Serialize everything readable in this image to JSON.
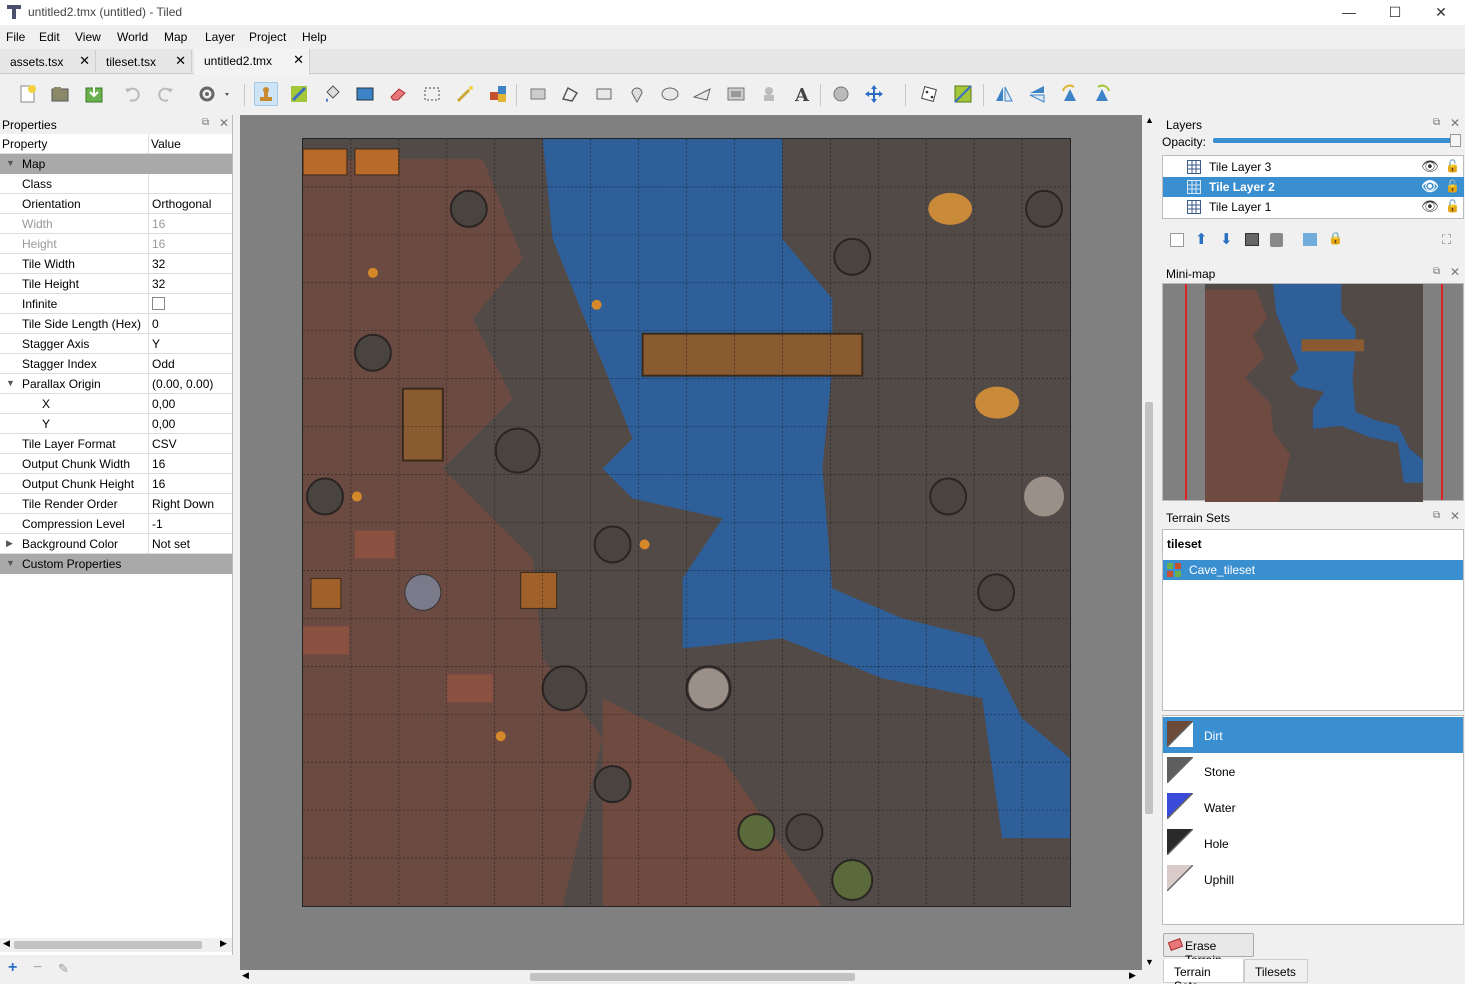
{
  "window": {
    "title": "untitled2.tmx (untitled) - Tiled",
    "minimize": "—",
    "maximize": "☐",
    "close": "✕"
  },
  "menu": [
    "File",
    "Edit",
    "View",
    "World",
    "Map",
    "Layer",
    "Project",
    "Help"
  ],
  "tabs": [
    {
      "label": "assets.tsx"
    },
    {
      "label": "tileset.tsx"
    },
    {
      "label": "untitled2.tmx",
      "active": true
    }
  ],
  "properties": {
    "title": "Properties",
    "col_property": "Property",
    "col_value": "Value",
    "rows": [
      {
        "k": "Map",
        "v": "",
        "group": true
      },
      {
        "k": "Class",
        "v": ""
      },
      {
        "k": "Orientation",
        "v": "Orthogonal"
      },
      {
        "k": "Width",
        "v": "16",
        "dis": true
      },
      {
        "k": "Height",
        "v": "16",
        "dis": true
      },
      {
        "k": "Tile Width",
        "v": "32"
      },
      {
        "k": "Tile Height",
        "v": "32"
      },
      {
        "k": "Infinite",
        "v": ""
      },
      {
        "k": "Tile Side Length (Hex)",
        "v": "0"
      },
      {
        "k": "Stagger Axis",
        "v": "Y"
      },
      {
        "k": "Stagger Index",
        "v": "Odd"
      },
      {
        "k": "Parallax Origin",
        "v": "(0.00, 0.00)"
      },
      {
        "k": "X",
        "v": "0,00"
      },
      {
        "k": "Y",
        "v": "0,00"
      },
      {
        "k": "Tile Layer Format",
        "v": "CSV"
      },
      {
        "k": "Output Chunk Width",
        "v": "16"
      },
      {
        "k": "Output Chunk Height",
        "v": "16"
      },
      {
        "k": "Tile Render Order",
        "v": "Right Down"
      },
      {
        "k": "Compression Level",
        "v": "-1"
      },
      {
        "k": "Background Color",
        "v": "Not set"
      },
      {
        "k": "Custom Properties",
        "v": "",
        "group": true
      }
    ]
  },
  "layers": {
    "title": "Layers",
    "opacity_label": "Opacity:",
    "items": [
      "Tile Layer 3",
      "Tile Layer 2",
      "Tile Layer 1"
    ],
    "selected": 1
  },
  "minimap": {
    "title": "Mini-map"
  },
  "terrain": {
    "title": "Terrain Sets",
    "tileset": "tileset",
    "set_name": "Cave_tileset",
    "items": [
      {
        "name": "Dirt",
        "color": "#6b4a3a"
      },
      {
        "name": "Stone",
        "color": "#5e5e5e"
      },
      {
        "name": "Water",
        "color": "#3b4bd8"
      },
      {
        "name": "Hole",
        "color": "#2a2a2a"
      },
      {
        "name": "Uphill",
        "color": "#d8cbc8"
      }
    ],
    "erase_label": "Erase Terrain"
  },
  "bottom_tabs": [
    "Terrain Sets",
    "Tilesets"
  ],
  "colors": {
    "accent": "#3a8fd1",
    "water": "#2f5f99",
    "dirt": "#6e4a40",
    "stone": "#524a47"
  }
}
